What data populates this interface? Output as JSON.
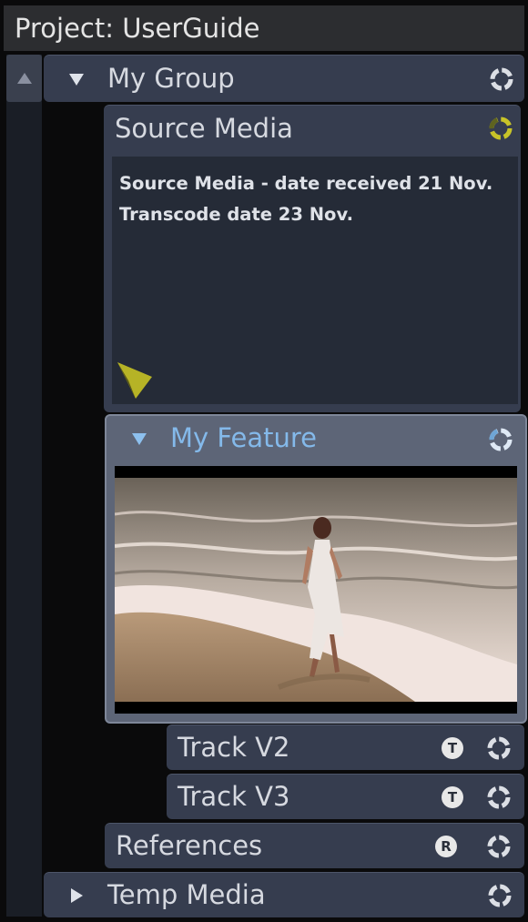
{
  "project": {
    "title": "Project: UserGuide"
  },
  "tree": {
    "group": {
      "label": "My Group"
    },
    "source_media": {
      "label": "Source Media",
      "note_lines": [
        "Source Media - date received 21 Nov.",
        "Transcode date 23 Nov."
      ]
    },
    "feature": {
      "label": "My Feature"
    },
    "tracks": [
      {
        "label": "Track V2",
        "badge": "T"
      },
      {
        "label": "Track V3",
        "badge": "T"
      }
    ],
    "references": {
      "label": "References",
      "badge": "R"
    },
    "temp_media": {
      "label": "Temp Media"
    }
  },
  "colors": {
    "row_bg": "#363d4f",
    "feature_bg": "#5d6577",
    "accent_blue": "#84b9ea",
    "accent_yellow": "#c8c428"
  },
  "icons": [
    "scroll-up-icon",
    "disclosure-down-icon",
    "disclosure-right-icon",
    "sync-ring-icon",
    "note-flag-icon",
    "track-type-badge-icon"
  ]
}
